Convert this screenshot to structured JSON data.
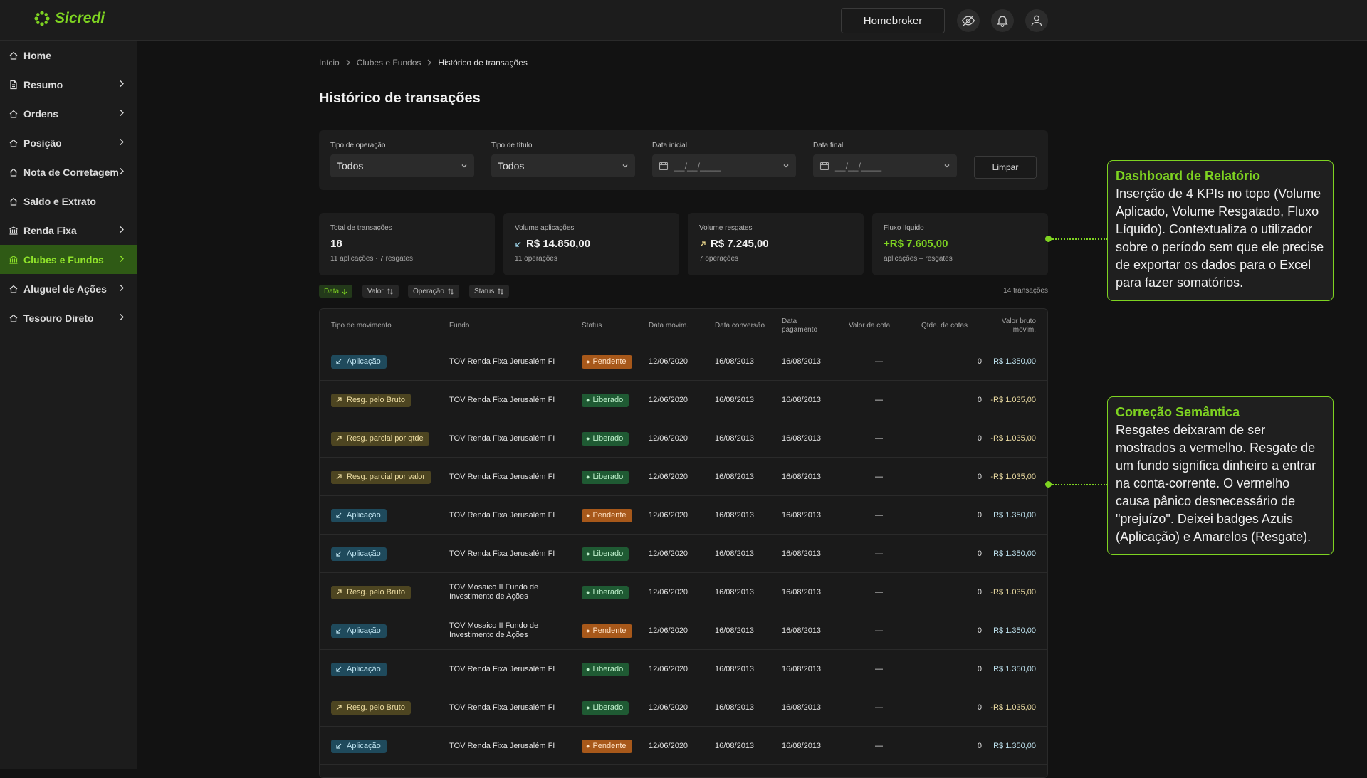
{
  "header": {
    "brand": "Sicredi",
    "homebroker_label": "Homebroker",
    "icons": [
      "eye-off-icon",
      "bell-icon",
      "user-icon"
    ]
  },
  "sidebar": {
    "items": [
      {
        "label": "Home",
        "icon": "home-icon",
        "chevron": false,
        "active": false
      },
      {
        "label": "Resumo",
        "icon": "document-icon",
        "chevron": true,
        "active": false
      },
      {
        "label": "Ordens",
        "icon": "home-icon",
        "chevron": true,
        "active": false
      },
      {
        "label": "Posição",
        "icon": "home-icon",
        "chevron": true,
        "active": false
      },
      {
        "label": "Nota de Corretagem",
        "icon": "home-icon",
        "chevron": true,
        "active": false
      },
      {
        "label": "Saldo e Extrato",
        "icon": "home-icon",
        "chevron": false,
        "active": false
      },
      {
        "label": "Renda Fixa",
        "icon": "bank-icon",
        "chevron": true,
        "active": false
      },
      {
        "label": "Clubes e Fundos",
        "icon": "bank-icon",
        "chevron": true,
        "active": true
      },
      {
        "label": "Aluguel de Ações",
        "icon": "home-icon",
        "chevron": true,
        "active": false
      },
      {
        "label": "Tesouro Direto",
        "icon": "home-icon",
        "chevron": true,
        "active": false
      }
    ]
  },
  "breadcrumb": {
    "items": [
      "Início",
      "Clubes e Fundos",
      "Histórico de transações"
    ]
  },
  "page_title": "Histórico de transações",
  "filters": {
    "tipo_operacao": {
      "label": "Tipo de operação",
      "value": "Todos"
    },
    "tipo_titulo": {
      "label": "Tipo de título",
      "value": "Todos"
    },
    "data_inicial": {
      "label": "Data inicial",
      "placeholder": "__/__/____"
    },
    "data_final": {
      "label": "Data final",
      "placeholder": "__/__/____"
    },
    "clear_label": "Limpar"
  },
  "kpis": [
    {
      "label": "Total de transações",
      "value": "18",
      "sub": "11 aplicações · 7 resgates",
      "icon": ""
    },
    {
      "label": "Volume aplicações",
      "value": "R$ 14.850,00",
      "sub": "11 operações",
      "icon": "arrow-in-icon"
    },
    {
      "label": "Volume resgates",
      "value": "R$ 7.245,00",
      "sub": "7 operações",
      "icon": "arrow-out-icon"
    },
    {
      "label": "Fluxo líquido",
      "value": "+R$ 7.605,00",
      "sub": "aplicações – resgates",
      "icon": ""
    }
  ],
  "sort_chips": [
    {
      "label": "Data",
      "active": true,
      "icon": "arrow-down-icon"
    },
    {
      "label": "Valor",
      "active": false,
      "icon": "sort-icon"
    },
    {
      "label": "Operação",
      "active": false,
      "icon": "sort-icon"
    },
    {
      "label": "Status",
      "active": false,
      "icon": "sort-icon"
    }
  ],
  "tx_count": "14 transações",
  "table": {
    "columns": [
      "Tipo de movimento",
      "Fundo",
      "Status",
      "Data movim.",
      "Data conversão",
      "Data pagamento",
      "Valor da cota",
      "Qtde. de cotas",
      "Valor bruto movim."
    ],
    "rows": [
      {
        "tipo": "Aplicação",
        "kind": "aplic",
        "fundo": "TOV Renda Fixa Jerusalém FI",
        "status": "Pendente",
        "skind": "pend",
        "dmov": "12/06/2020",
        "dconv": "16/08/2013",
        "dpag": "16/08/2013",
        "cota": "—",
        "qtde": "0",
        "valor": "R$ 1.350,00"
      },
      {
        "tipo": "Resg. pelo Bruto",
        "kind": "resg",
        "fundo": "TOV Renda Fixa Jerusalém FI",
        "status": "Liberado",
        "skind": "lib",
        "dmov": "12/06/2020",
        "dconv": "16/08/2013",
        "dpag": "16/08/2013",
        "cota": "—",
        "qtde": "0",
        "valor": "-R$ 1.035,00"
      },
      {
        "tipo": "Resg. parcial por qtde",
        "kind": "resg",
        "fundo": "TOV Renda Fixa Jerusalém FI",
        "status": "Liberado",
        "skind": "lib",
        "dmov": "12/06/2020",
        "dconv": "16/08/2013",
        "dpag": "16/08/2013",
        "cota": "—",
        "qtde": "0",
        "valor": "-R$ 1.035,00"
      },
      {
        "tipo": "Resg. parcial por valor",
        "kind": "resg",
        "fundo": "TOV Renda Fixa Jerusalém FI",
        "status": "Liberado",
        "skind": "lib",
        "dmov": "12/06/2020",
        "dconv": "16/08/2013",
        "dpag": "16/08/2013",
        "cota": "—",
        "qtde": "0",
        "valor": "-R$ 1.035,00"
      },
      {
        "tipo": "Aplicação",
        "kind": "aplic",
        "fundo": "TOV Renda Fixa Jerusalém FI",
        "status": "Pendente",
        "skind": "pend",
        "dmov": "12/06/2020",
        "dconv": "16/08/2013",
        "dpag": "16/08/2013",
        "cota": "—",
        "qtde": "0",
        "valor": "R$ 1.350,00"
      },
      {
        "tipo": "Aplicação",
        "kind": "aplic",
        "fundo": "TOV Renda Fixa Jerusalém FI",
        "status": "Liberado",
        "skind": "lib",
        "dmov": "12/06/2020",
        "dconv": "16/08/2013",
        "dpag": "16/08/2013",
        "cota": "—",
        "qtde": "0",
        "valor": "R$ 1.350,00"
      },
      {
        "tipo": "Resg. pelo Bruto",
        "kind": "resg",
        "fundo": "TOV Mosaico II Fundo de Investimento de Ações",
        "status": "Liberado",
        "skind": "lib",
        "dmov": "12/06/2020",
        "dconv": "16/08/2013",
        "dpag": "16/08/2013",
        "cota": "—",
        "qtde": "0",
        "valor": "-R$ 1.035,00"
      },
      {
        "tipo": "Aplicação",
        "kind": "aplic",
        "fundo": "TOV Mosaico II Fundo de Investimento de Ações",
        "status": "Pendente",
        "skind": "pend",
        "dmov": "12/06/2020",
        "dconv": "16/08/2013",
        "dpag": "16/08/2013",
        "cota": "—",
        "qtde": "0",
        "valor": "R$ 1.350,00"
      },
      {
        "tipo": "Aplicação",
        "kind": "aplic",
        "fundo": "TOV Renda Fixa Jerusalém FI",
        "status": "Liberado",
        "skind": "lib",
        "dmov": "12/06/2020",
        "dconv": "16/08/2013",
        "dpag": "16/08/2013",
        "cota": "—",
        "qtde": "0",
        "valor": "R$ 1.350,00"
      },
      {
        "tipo": "Resg. pelo Bruto",
        "kind": "resg",
        "fundo": "TOV Renda Fixa Jerusalém FI",
        "status": "Liberado",
        "skind": "lib",
        "dmov": "12/06/2020",
        "dconv": "16/08/2013",
        "dpag": "16/08/2013",
        "cota": "—",
        "qtde": "0",
        "valor": "-R$ 1.035,00"
      },
      {
        "tipo": "Aplicação",
        "kind": "aplic",
        "fundo": "TOV Renda Fixa Jerusalém FI",
        "status": "Pendente",
        "skind": "pend",
        "dmov": "12/06/2020",
        "dconv": "16/08/2013",
        "dpag": "16/08/2013",
        "cota": "—",
        "qtde": "0",
        "valor": "R$ 1.350,00"
      }
    ]
  },
  "annotations": [
    {
      "title": "Dashboard de Relatório",
      "body": "Inserção de 4 KPIs no topo (Volume Aplicado, Volume Resgatado, Fluxo Líquido). Contextualiza o utilizador sobre o período sem que ele precise de exportar os dados para o Excel para fazer somatórios."
    },
    {
      "title": "Correção Semântica",
      "body": "Resgates deixaram de ser mostrados a vermelho. Resgate de um fundo significa dinheiro a entrar na conta-corrente. O vermelho causa pânico desnecessário de \"prejuízo\". Deixei badges Azuis (Aplicação) e Amarelos (Resgate)."
    }
  ],
  "colors": {
    "accent": "#7ed321",
    "aplic_badge": "#1f4a5c",
    "resg_badge": "#4d4521",
    "pendente": "#a7581a",
    "liberado": "#1f5a33"
  }
}
